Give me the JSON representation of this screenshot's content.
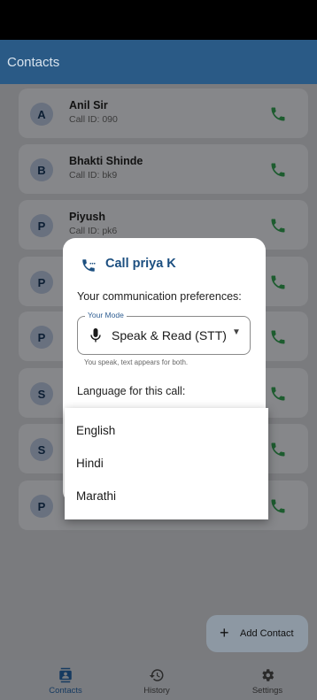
{
  "app_bar": {
    "title": "Contacts"
  },
  "contacts": [
    {
      "initial": "A",
      "name": "Anil Sir",
      "call_id": "Call ID: 090"
    },
    {
      "initial": "B",
      "name": "Bhakti Shinde",
      "call_id": "Call ID: bk9"
    },
    {
      "initial": "P",
      "name": "Piyush",
      "call_id": "Call ID: pk6"
    },
    {
      "initial": "P",
      "name": "",
      "call_id": ""
    },
    {
      "initial": "P",
      "name": "",
      "call_id": ""
    },
    {
      "initial": "S",
      "name": "",
      "call_id": ""
    },
    {
      "initial": "S",
      "name": "",
      "call_id": ""
    },
    {
      "initial": "P",
      "name": "",
      "call_id": ""
    }
  ],
  "dialog": {
    "icon": "phone-in-talk-icon",
    "title": "Call priya K",
    "preferences_label": "Your communication preferences:",
    "mode_legend": "Your Mode",
    "mode_value": "Speak & Read (STT)",
    "mode_helper": "You speak, text appears for both.",
    "language_label": "Language for this call:"
  },
  "language_menu": {
    "options": [
      "English",
      "Hindi",
      "Marathi"
    ]
  },
  "fab": {
    "label": "Add Contact",
    "icon": "plus-icon"
  },
  "bottom_nav": {
    "items": [
      {
        "label": "Contacts",
        "icon": "contacts-icon",
        "active": true
      },
      {
        "label": "History",
        "icon": "history-icon",
        "active": false
      },
      {
        "label": "Settings",
        "icon": "gear-icon",
        "active": false
      }
    ]
  },
  "colors": {
    "primary": "#2a5a86",
    "phone_green": "#1d5c2f",
    "dialog_title": "#1c4f80",
    "scrim": "#7a7b7e"
  }
}
